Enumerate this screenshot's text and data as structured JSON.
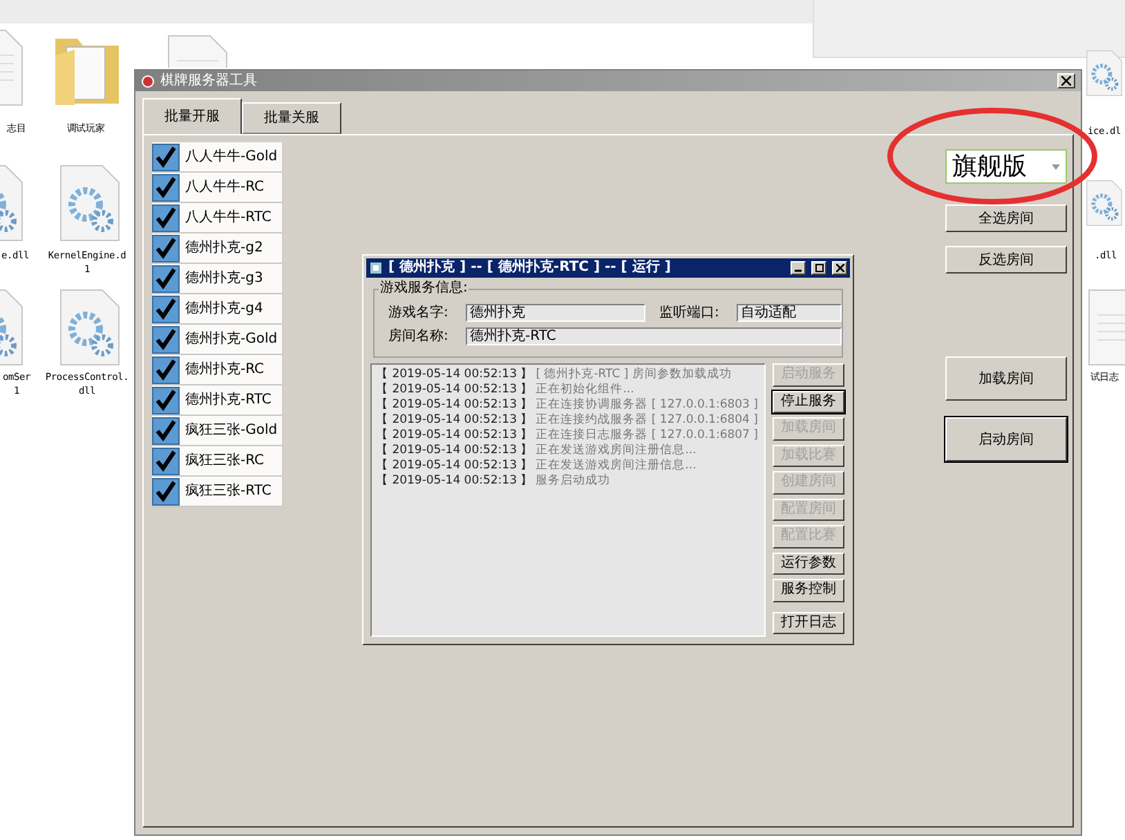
{
  "desktop": {
    "icons": [
      {
        "label": "志目",
        "kind": "file"
      },
      {
        "label": "调试玩家",
        "kind": "folder"
      },
      {
        "kind": "file"
      },
      {
        "label": "ice.dl",
        "kind": "gear"
      },
      {
        "label": "e.dll",
        "kind": "gear"
      },
      {
        "label": "KernelEngine.d\n1",
        "kind": "gear"
      },
      {
        "label": ".dll",
        "kind": "gear"
      },
      {
        "label": "omSer\n1",
        "kind": "gear"
      },
      {
        "label": "ProcessControl.\ndll",
        "kind": "gear"
      },
      {
        "label": "试日志",
        "kind": "file"
      }
    ]
  },
  "window": {
    "title": "棋牌服务器工具",
    "tabs": [
      {
        "label": "批量开服",
        "selected": true
      },
      {
        "label": "批量关服",
        "selected": false
      }
    ],
    "rooms": [
      {
        "label": "八人牛牛-Gold",
        "checked": true
      },
      {
        "label": "八人牛牛-RC",
        "checked": true
      },
      {
        "label": "八人牛牛-RTC",
        "checked": true
      },
      {
        "label": "德州扑克-g2",
        "checked": true
      },
      {
        "label": "德州扑克-g3",
        "checked": true
      },
      {
        "label": "德州扑克-g4",
        "checked": true
      },
      {
        "label": "德州扑克-Gold",
        "checked": true
      },
      {
        "label": "德州扑克-RC",
        "checked": true
      },
      {
        "label": "德州扑克-RTC",
        "checked": true
      },
      {
        "label": "疯狂三张-Gold",
        "checked": true
      },
      {
        "label": "疯狂三张-RC",
        "checked": true
      },
      {
        "label": "疯狂三张-RTC",
        "checked": true
      }
    ],
    "edition": {
      "value": "旗舰版"
    },
    "buttons": [
      {
        "label": "全选房间"
      },
      {
        "label": "反选房间"
      },
      {
        "label": "加载房间"
      },
      {
        "label": "启动房间"
      }
    ]
  },
  "service_window": {
    "title": "[ 德州扑克 ] -- [ 德州扑克-RTC ] -- [ 运行 ]",
    "group_title": "游戏服务信息:",
    "fields": [
      {
        "label": "游戏名字:",
        "value": "德州扑克"
      },
      {
        "label": "监听端口:",
        "value": "自动适配"
      },
      {
        "label": "房间名称:",
        "value": "德州扑克-RTC"
      }
    ],
    "log": [
      {
        "time": "【 2019-05-14 00:52:13 】",
        "message": "[ 德州扑克-RTC ] 房间参数加载成功"
      },
      {
        "time": "【 2019-05-14 00:52:13 】",
        "message": "正在初始化组件..."
      },
      {
        "time": "【 2019-05-14 00:52:13 】",
        "message": "正在连接协调服务器 [ 127.0.0.1:6803 ]"
      },
      {
        "time": "【 2019-05-14 00:52:13 】",
        "message": "正在连接约战服务器 [ 127.0.0.1:6804 ]"
      },
      {
        "time": "【 2019-05-14 00:52:13 】",
        "message": "正在连接日志服务器 [ 127.0.0.1:6807 ]"
      },
      {
        "time": "【 2019-05-14 00:52:13 】",
        "message": "正在发送游戏房间注册信息..."
      },
      {
        "time": "【 2019-05-14 00:52:13 】",
        "message": "正在发送游戏房间注册信息..."
      },
      {
        "time": "【 2019-05-14 00:52:13 】",
        "message": "服务启动成功"
      }
    ],
    "buttons": [
      {
        "label": "启动服务",
        "disabled": true
      },
      {
        "label": "停止服务",
        "disabled": false
      },
      {
        "label": "加载房间",
        "disabled": true
      },
      {
        "label": "加载比赛",
        "disabled": true
      },
      {
        "label": "创建房间",
        "disabled": true
      },
      {
        "label": "配置房间",
        "disabled": true
      },
      {
        "label": "配置比赛",
        "disabled": true
      },
      {
        "label": "运行参数",
        "disabled": false
      },
      {
        "label": "服务控制",
        "disabled": false
      },
      {
        "label": "打开日志",
        "disabled": false
      }
    ]
  }
}
